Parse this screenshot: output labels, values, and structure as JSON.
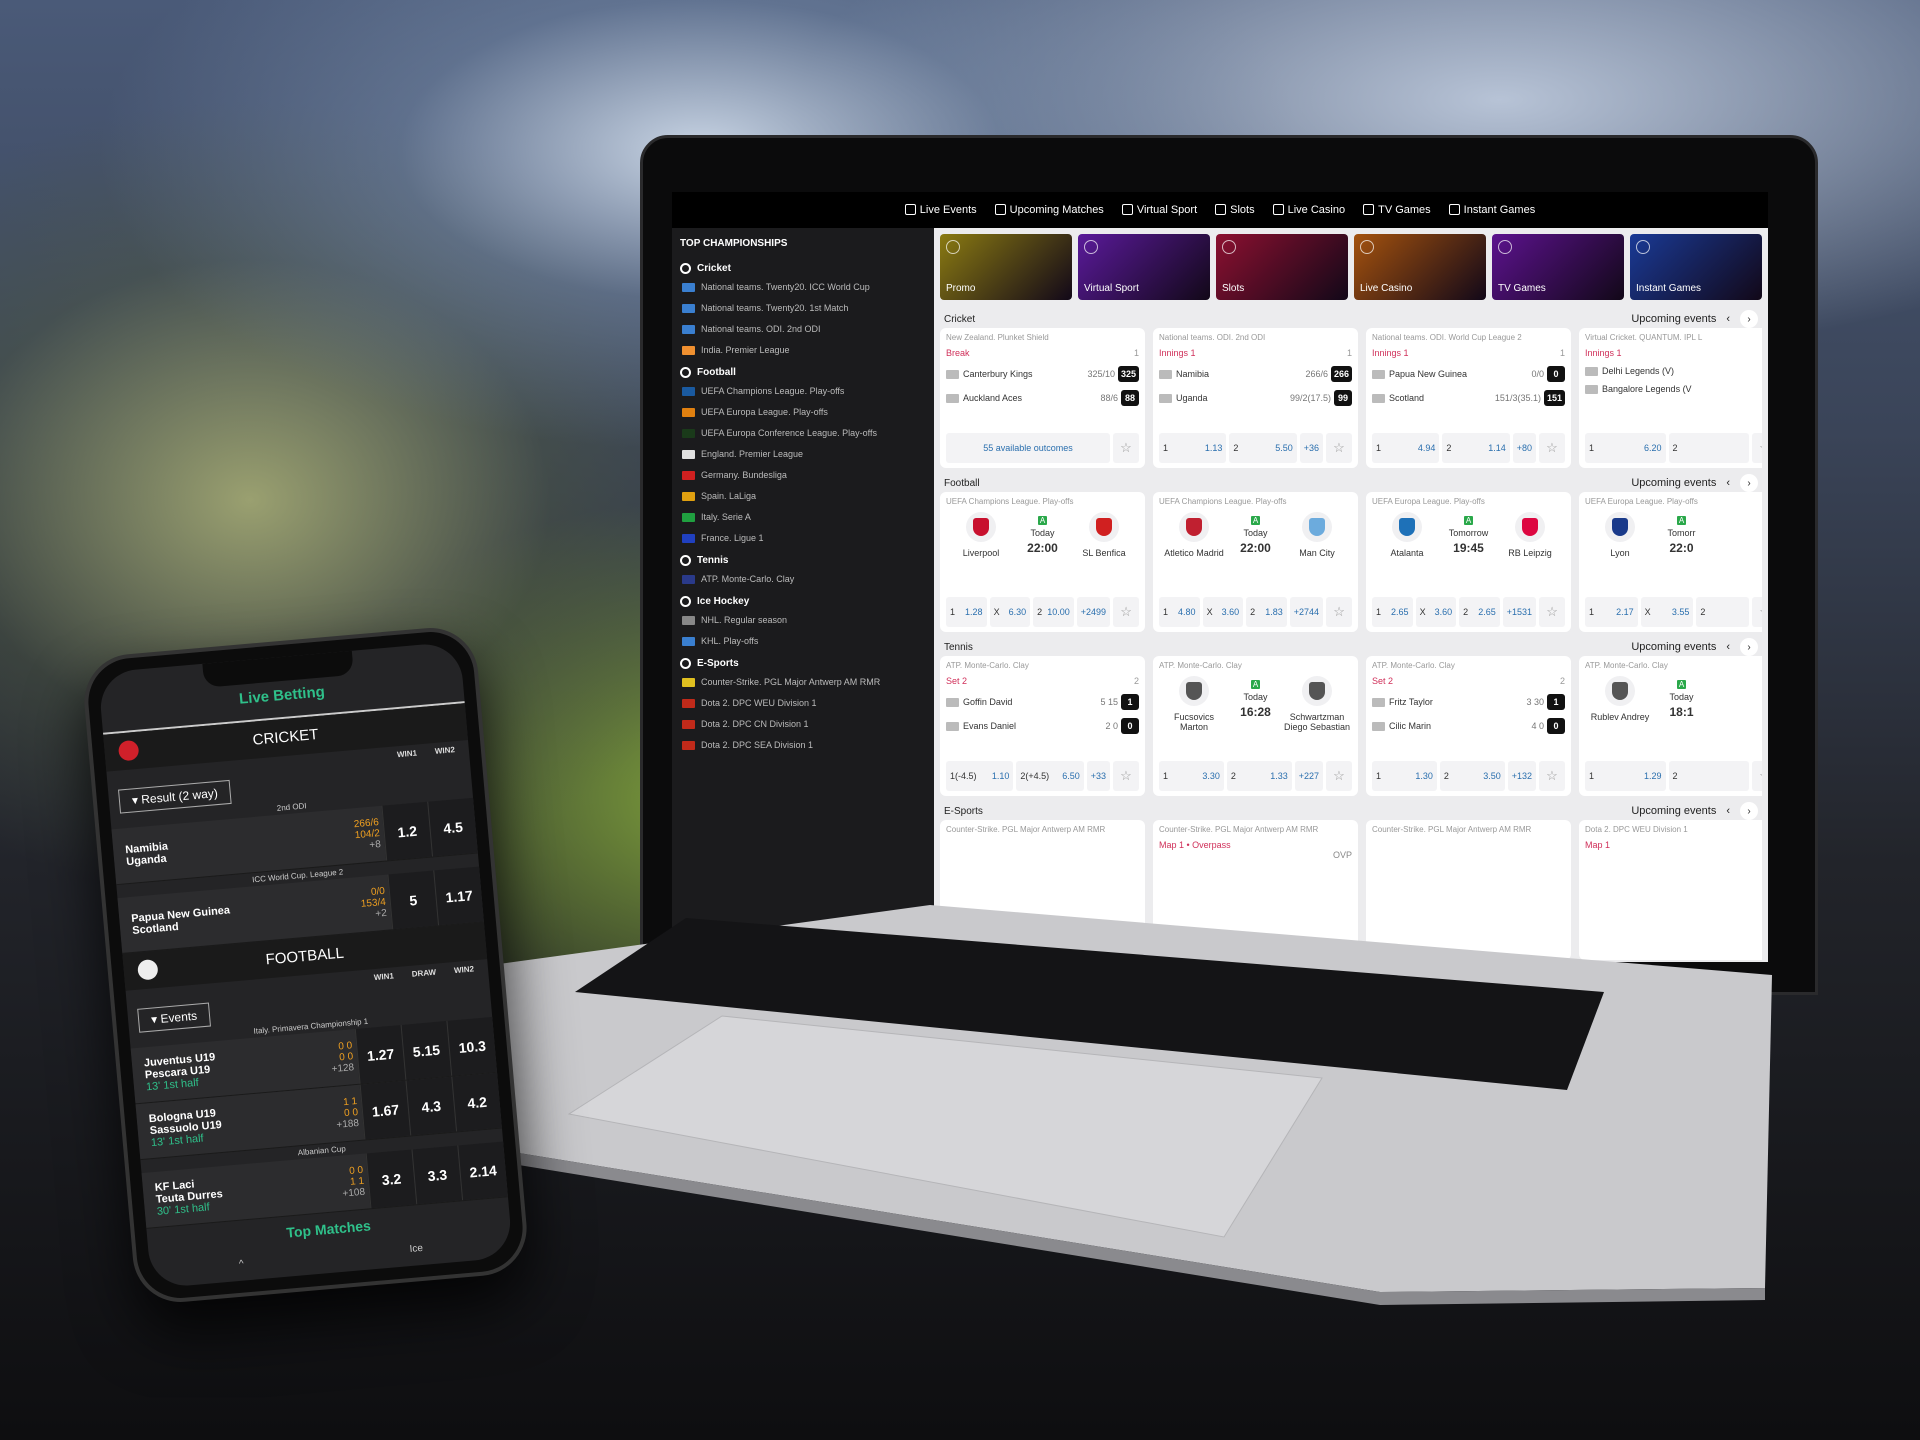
{
  "laptop": {
    "nav": [
      {
        "label": "Live Events",
        "icon": "live-icon"
      },
      {
        "label": "Upcoming Matches",
        "icon": "calendar-icon"
      },
      {
        "label": "Virtual Sport",
        "icon": "virtual-sport-icon"
      },
      {
        "label": "Slots",
        "icon": "slots-icon"
      },
      {
        "label": "Live Casino",
        "icon": "live-casino-icon"
      },
      {
        "label": "TV Games",
        "icon": "tv-icon"
      },
      {
        "label": "Instant Games",
        "icon": "rocket-icon"
      }
    ],
    "tiles": [
      {
        "label": "Promo",
        "color": "#8a7a12"
      },
      {
        "label": "Virtual Sport",
        "color": "#5a1a9a"
      },
      {
        "label": "Slots",
        "color": "#8c1030"
      },
      {
        "label": "Live Casino",
        "color": "#a4520e"
      },
      {
        "label": "TV Games",
        "color": "#5c128e"
      },
      {
        "label": "Instant Games",
        "color": "#1a3a96"
      }
    ],
    "sidebar": {
      "title": "TOP CHAMPIONSHIPS",
      "groups": [
        {
          "label": "Cricket",
          "items": [
            {
              "label": "National teams. Twenty20. ICC World Cup",
              "flag": "#3a7fd0"
            },
            {
              "label": "National teams. Twenty20. 1st Match",
              "flag": "#3a7fd0"
            },
            {
              "label": "National teams. ODI. 2nd ODI",
              "flag": "#3a7fd0"
            },
            {
              "label": "India. Premier League",
              "flag": "#f09030"
            }
          ]
        },
        {
          "label": "Football",
          "items": [
            {
              "label": "UEFA Champions League. Play-offs",
              "flag": "#1a5aa0"
            },
            {
              "label": "UEFA Europa League. Play-offs",
              "flag": "#e08010"
            },
            {
              "label": "UEFA Europa Conference League. Play-offs",
              "flag": "#1a3a1a"
            },
            {
              "label": "England. Premier League",
              "flag": "#e0e0e0"
            },
            {
              "label": "Germany. Bundesliga",
              "flag": "#d02020"
            },
            {
              "label": "Spain. LaLiga",
              "flag": "#e0a010"
            },
            {
              "label": "Italy. Serie A",
              "flag": "#20a040"
            },
            {
              "label": "France. Ligue 1",
              "flag": "#2040c0"
            }
          ]
        },
        {
          "label": "Tennis",
          "items": [
            {
              "label": "ATP. Monte-Carlo. Clay",
              "flag": "#2a3a8a"
            }
          ]
        },
        {
          "label": "Ice Hockey",
          "items": [
            {
              "label": "NHL. Regular season",
              "flag": "#888"
            },
            {
              "label": "KHL. Play-offs",
              "flag": "#3a7fd0"
            }
          ]
        },
        {
          "label": "E-Sports",
          "items": [
            {
              "label": "Counter-Strike. PGL Major Antwerp AM RMR",
              "flag": "#e0c020"
            },
            {
              "label": "Dota 2. DPC WEU Division 1",
              "flag": "#c02a1a"
            },
            {
              "label": "Dota 2. DPC CN Division 1",
              "flag": "#c02a1a"
            },
            {
              "label": "Dota 2. DPC SEA Division 1",
              "flag": "#c02a1a"
            }
          ]
        }
      ]
    },
    "sections": [
      {
        "title": "Cricket",
        "upcoming": "Upcoming events",
        "cards": [
          {
            "type": "live",
            "league": "New Zealand. Plunket Shield",
            "status": "Break",
            "col": "1",
            "rows": [
              {
                "name": "Canterbury Kings",
                "score": "325/10",
                "box": "325"
              },
              {
                "name": "Auckland Aces",
                "score": "88/6",
                "box": "88"
              }
            ],
            "outcomes": "55 available outcomes"
          },
          {
            "type": "live",
            "league": "National teams. ODI. 2nd ODI",
            "status": "Innings 1",
            "col": "1",
            "rows": [
              {
                "name": "Namibia",
                "score": "266/6",
                "box": "266"
              },
              {
                "name": "Uganda",
                "score": "99/2(17.5)",
                "box": "99"
              }
            ],
            "odds": [
              {
                "l": "1",
                "v": "1.13"
              },
              {
                "l": "2",
                "v": "5.50"
              }
            ],
            "more": "+36"
          },
          {
            "type": "live",
            "league": "National teams. ODI. World Cup League 2",
            "status": "Innings 1",
            "col": "1",
            "rows": [
              {
                "name": "Papua New Guinea",
                "score": "0/0",
                "box": "0"
              },
              {
                "name": "Scotland",
                "score": "151/3(35.1)",
                "box": "151"
              }
            ],
            "odds": [
              {
                "l": "1",
                "v": "4.94"
              },
              {
                "l": "2",
                "v": "1.14"
              }
            ],
            "more": "+80"
          },
          {
            "type": "live",
            "league": "Virtual Cricket. QUANTUM. IPL L",
            "status": "Innings 1",
            "col": "",
            "rows": [
              {
                "name": "Delhi Legends (V)",
                "score": "",
                "box": ""
              },
              {
                "name": "Bangalore Legends (V",
                "score": "",
                "box": ""
              }
            ],
            "odds": [
              {
                "l": "1",
                "v": "6.20"
              },
              {
                "l": "2",
                "v": ""
              }
            ]
          }
        ]
      },
      {
        "title": "Football",
        "upcoming": "Upcoming events",
        "cards": [
          {
            "type": "pre",
            "league": "UEFA Champions League. Play-offs",
            "home": "Liverpool",
            "away": "SL Benfica",
            "day": "Today",
            "time": "22:00",
            "hc": "#c8102e",
            "ac": "#d02020",
            "odds": [
              {
                "l": "1",
                "v": "1.28"
              },
              {
                "l": "X",
                "v": "6.30"
              },
              {
                "l": "2",
                "v": "10.00"
              }
            ],
            "more": "+2499"
          },
          {
            "type": "pre",
            "league": "UEFA Champions League. Play-offs",
            "home": "Atletico Madrid",
            "away": "Man City",
            "day": "Today",
            "time": "22:00",
            "hc": "#c02030",
            "ac": "#6cabdd",
            "odds": [
              {
                "l": "1",
                "v": "4.80"
              },
              {
                "l": "X",
                "v": "3.60"
              },
              {
                "l": "2",
                "v": "1.83"
              }
            ],
            "more": "+2744"
          },
          {
            "type": "pre",
            "league": "UEFA Europa League. Play-offs",
            "home": "Atalanta",
            "away": "RB Leipzig",
            "day": "Tomorrow",
            "time": "19:45",
            "hc": "#1e71b8",
            "ac": "#dd0741",
            "odds": [
              {
                "l": "1",
                "v": "2.65"
              },
              {
                "l": "X",
                "v": "3.60"
              },
              {
                "l": "2",
                "v": "2.65"
              }
            ],
            "more": "+1531"
          },
          {
            "type": "pre",
            "league": "UEFA Europa League. Play-offs",
            "home": "Lyon",
            "away": "",
            "day": "Tomorr",
            "time": "22:0",
            "hc": "#1a3a8a",
            "ac": "",
            "odds": [
              {
                "l": "1",
                "v": "2.17"
              },
              {
                "l": "X",
                "v": "3.55"
              },
              {
                "l": "2",
                "v": ""
              }
            ]
          }
        ]
      },
      {
        "title": "Tennis",
        "upcoming": "Upcoming events",
        "cards": [
          {
            "type": "live",
            "league": "ATP. Monte-Carlo. Clay",
            "status": "Set 2",
            "col": "2",
            "rows": [
              {
                "name": "Goffin David",
                "score": "5 15",
                "box": "1"
              },
              {
                "name": "Evans Daniel",
                "score": "2 0",
                "box": "0"
              }
            ],
            "odds": [
              {
                "l": "1(-4.5)",
                "v": "1.10"
              },
              {
                "l": "2(+4.5)",
                "v": "6.50"
              }
            ],
            "more": "+33"
          },
          {
            "type": "pre",
            "league": "ATP. Monte-Carlo. Clay",
            "home": "Fucsovics Marton",
            "away": "Schwartzman Diego Sebastian",
            "day": "Today",
            "time": "16:28",
            "hc": "#555",
            "ac": "#555",
            "odds": [
              {
                "l": "1",
                "v": "3.30"
              },
              {
                "l": "2",
                "v": "1.33"
              }
            ],
            "more": "+227"
          },
          {
            "type": "live",
            "league": "ATP. Monte-Carlo. Clay",
            "status": "Set 2",
            "col": "2",
            "rows": [
              {
                "name": "Fritz Taylor",
                "score": "3 30",
                "box": "1"
              },
              {
                "name": "Cilic Marin",
                "score": "4 0",
                "box": "0"
              }
            ],
            "odds": [
              {
                "l": "1",
                "v": "1.30"
              },
              {
                "l": "2",
                "v": "3.50"
              }
            ],
            "more": "+132"
          },
          {
            "type": "pre",
            "league": "ATP. Monte-Carlo. Clay",
            "home": "Rublev Andrey",
            "away": "",
            "day": "Today",
            "time": "18:1",
            "hc": "#555",
            "ac": "",
            "odds": [
              {
                "l": "1",
                "v": "1.29"
              },
              {
                "l": "2",
                "v": ""
              }
            ]
          }
        ]
      },
      {
        "title": "E-Sports",
        "upcoming": "Upcoming events",
        "cards": [
          {
            "type": "es",
            "league": "Counter-Strike. PGL Major Antwerp AM RMR",
            "status": ""
          },
          {
            "type": "es",
            "league": "Counter-Strike. PGL Major Antwerp AM RMR",
            "status": "Map 1 • Overpass",
            "map": "OVP"
          },
          {
            "type": "es",
            "league": "Counter-Strike. PGL Major Antwerp AM RMR",
            "status": ""
          },
          {
            "type": "es",
            "league": "Dota 2. DPC WEU Division 1",
            "status": "Map 1"
          }
        ]
      }
    ]
  },
  "phone": {
    "title": "Live Betting",
    "cricket": {
      "title": "CRICKET",
      "cols": [
        "WIN1",
        "WIN2"
      ],
      "dropdown": "Result (2 way)",
      "matches": [
        {
          "league": "2nd ODI",
          "teams": [
            "Namibia",
            "Uganda"
          ],
          "scores": [
            "266/6",
            "104/2"
          ],
          "more": "+8",
          "odds": [
            "1.2",
            "4.5"
          ]
        },
        {
          "league": "ICC World Cup. League 2",
          "teams": [
            "Papua New Guinea",
            "Scotland"
          ],
          "scores": [
            "0/0",
            "153/4"
          ],
          "more": "+2",
          "odds": [
            "5",
            "1.17"
          ]
        }
      ]
    },
    "football": {
      "title": "FOOTBALL",
      "cols": [
        "WIN1",
        "DRAW",
        "WIN2"
      ],
      "dropdown": "Events",
      "matches": [
        {
          "league": "Italy. Primavera Championship 1",
          "teams": [
            "Juventus U19",
            "Pescara U19"
          ],
          "time": "13' 1st half",
          "scores": [
            "0 0",
            "0 0"
          ],
          "more": "+128",
          "odds": [
            "1.27",
            "5.15",
            "10.3"
          ]
        },
        {
          "league": "",
          "teams": [
            "Bologna U19",
            "Sassuolo U19"
          ],
          "time": "13' 1st half",
          "scores": [
            "1 1",
            "0 0"
          ],
          "more": "+188",
          "odds": [
            "1.67",
            "4.3",
            "4.2"
          ]
        },
        {
          "league": "Albanian Cup",
          "teams": [
            "KF Laci",
            "Teuta Durres"
          ],
          "time": "30' 1st half",
          "scores": [
            "0 0",
            "1 1"
          ],
          "more": "+108",
          "odds": [
            "3.2",
            "3.3",
            "2.14"
          ]
        }
      ]
    },
    "top_matches": "Top Matches",
    "bottom_tab": "Ice"
  }
}
